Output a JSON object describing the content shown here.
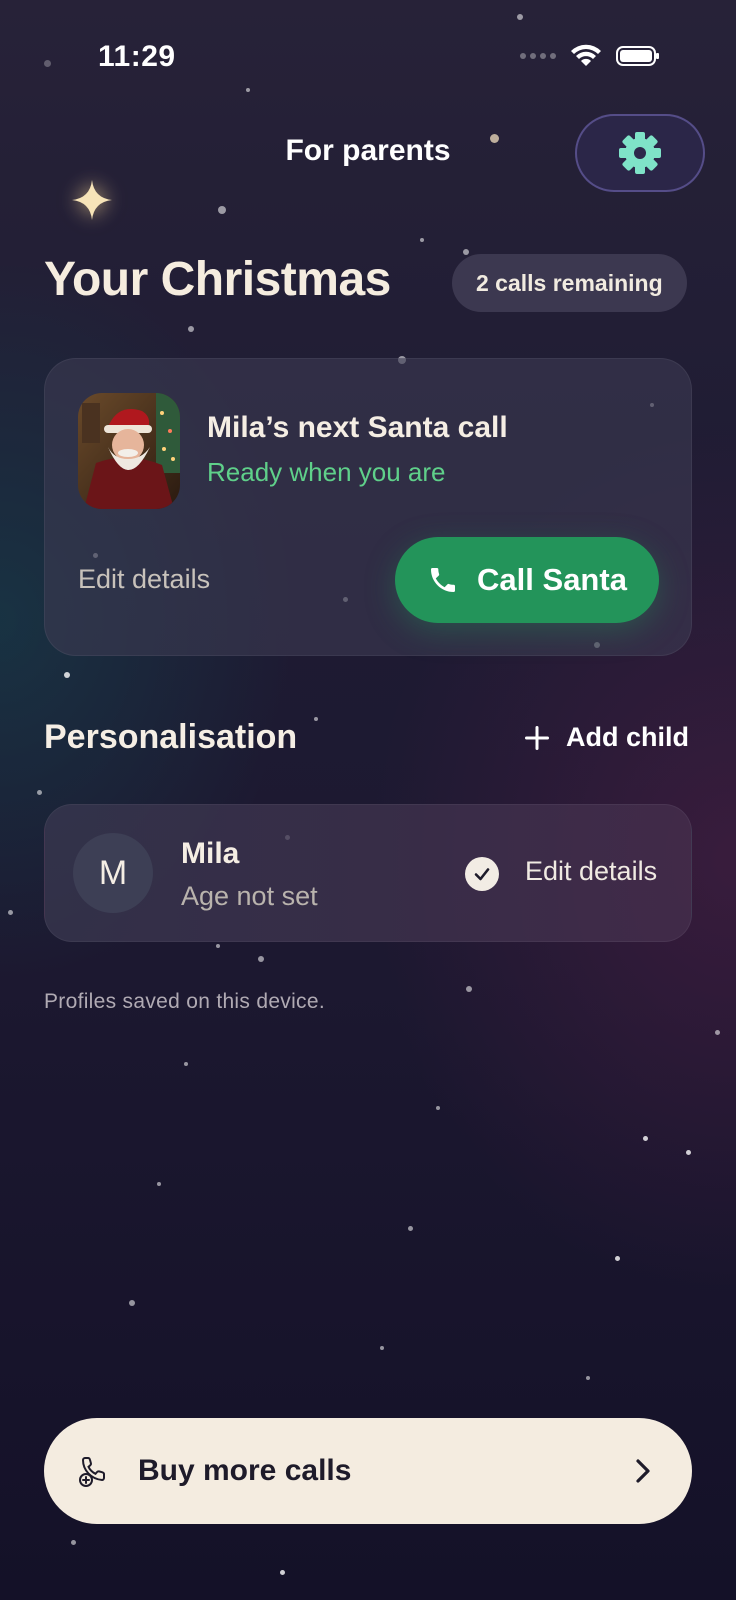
{
  "status_bar": {
    "time": "11:29"
  },
  "header": {
    "title": "For parents"
  },
  "hero": {
    "title": "Your Christmas",
    "calls_remaining": "2 calls remaining"
  },
  "next_call_card": {
    "title": "Mila’s next Santa call",
    "status": "Ready when you are",
    "edit_label": "Edit details",
    "call_button_label": "Call Santa"
  },
  "personalisation": {
    "title": "Personalisation",
    "add_child_label": "Add child",
    "children": [
      {
        "initial": "M",
        "name": "Mila",
        "age": "Age not set",
        "edit_label": "Edit details"
      }
    ],
    "footnote": "Profiles saved on this device."
  },
  "buy_button": {
    "label": "Buy more calls"
  },
  "colors": {
    "accent_green": "#23945a",
    "status_green": "#5fd08a",
    "settings_icon": "#7fe3c8",
    "cream": "#f4ece0"
  },
  "icons": [
    "wifi-icon",
    "battery-icon",
    "gear-icon",
    "sparkle-icon",
    "phone-icon",
    "plus-icon",
    "check-icon",
    "phone-add-icon",
    "chevron-right-icon"
  ]
}
